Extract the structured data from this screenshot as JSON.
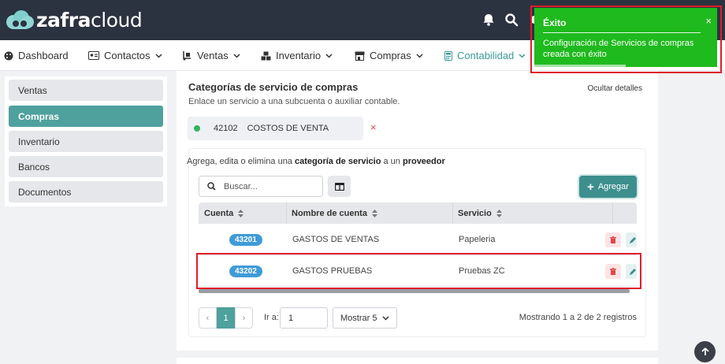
{
  "brand": {
    "name_bold": "zafra",
    "name_light": "cloud"
  },
  "topbar": {
    "icons": [
      "bell-icon",
      "search-icon",
      "gear-icon"
    ]
  },
  "nav": {
    "items": [
      {
        "label": "Dashboard",
        "icon": "palette-icon"
      },
      {
        "label": "Contactos",
        "icon": "id-card-icon"
      },
      {
        "label": "Ventas",
        "icon": "dolly-icon"
      },
      {
        "label": "Inventario",
        "icon": "boxes-icon"
      },
      {
        "label": "Compras",
        "icon": "store-icon"
      },
      {
        "label": "Contabilidad",
        "icon": "calculator-icon"
      }
    ]
  },
  "sidebar": {
    "items": [
      {
        "label": "Ventas"
      },
      {
        "label": "Compras"
      },
      {
        "label": "Inventario"
      },
      {
        "label": "Bancos"
      },
      {
        "label": "Documentos"
      }
    ],
    "active": "Compras"
  },
  "section": {
    "title": "Categorías de servicio de compras",
    "subtitle": "Enlace un servicio a una subcuenta o auxiliar contable.",
    "hide_details": "Ocultar detalles",
    "account": {
      "code": "42102",
      "name": "COSTOS DE VENTA",
      "remove": "×"
    }
  },
  "card": {
    "intro_1": "Agrega, edita o elimina una ",
    "intro_b1": "categoría de servicio",
    "intro_2": " a un ",
    "intro_b2": "proveedor",
    "search_placeholder": "Buscar...",
    "add_label": "Agregar"
  },
  "table": {
    "headers": {
      "cuenta": "Cuenta",
      "nombre": "Nombre de cuenta",
      "servicio": "Servicio"
    },
    "rows": [
      {
        "cuenta": "43201",
        "nombre": "GASTOS DE VENTAS",
        "servicio": "Papeleria"
      },
      {
        "cuenta": "43202",
        "nombre": "GASTOS PRUEBAS",
        "servicio": "Pruebas ZC"
      }
    ]
  },
  "pagination": {
    "prev": "‹",
    "current": "1",
    "next": "›",
    "goto_label": "Ir a:",
    "goto_value": "1",
    "show_label": "Mostrar 5",
    "records": "Mostrando 1 a 2 de 2 registros"
  },
  "toast": {
    "title": "Éxito",
    "close": "×",
    "message": "Configuración de Servicios de compras creada con éxito",
    "progress": 0.5
  },
  "colors": {
    "accent": "#4ea19c",
    "topbar": "#2b3240",
    "toast": "#1fba1e",
    "highlight": "#e11d2a",
    "badge": "#3f9bd8"
  }
}
